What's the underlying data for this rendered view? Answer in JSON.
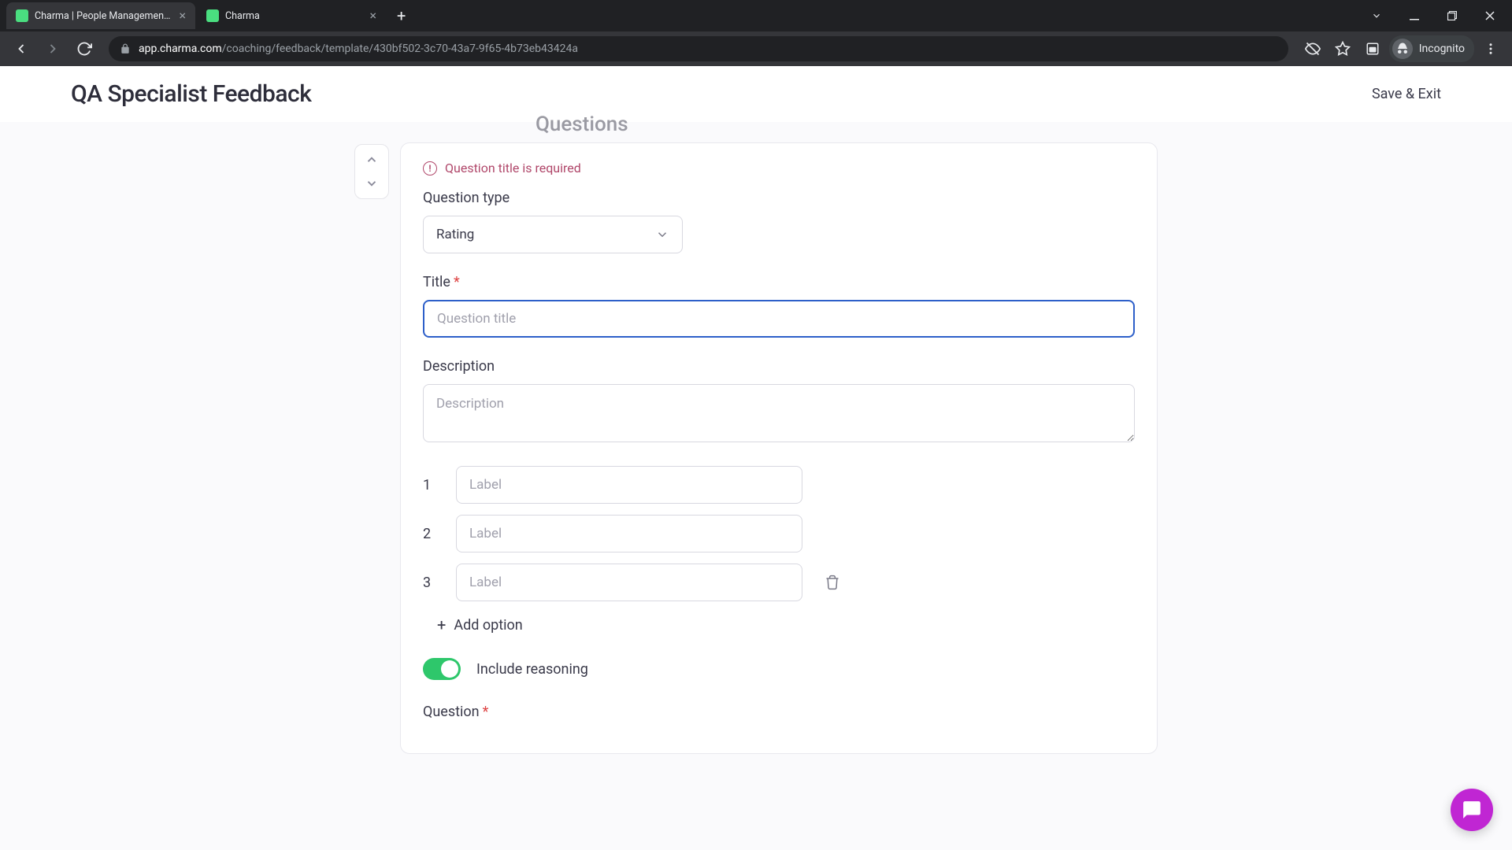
{
  "browser": {
    "tabs": [
      {
        "title": "Charma | People Management S",
        "active": true
      },
      {
        "title": "Charma",
        "active": false
      }
    ],
    "url_host": "app.charma.com",
    "url_path": "/coaching/feedback/template/430bf502-3c70-43a7-9f65-4b73eb43424a",
    "incognito_label": "Incognito"
  },
  "header": {
    "title": "QA Specialist Feedback",
    "save_exit": "Save & Exit"
  },
  "section": {
    "heading": "Questions"
  },
  "question": {
    "error_text": "Question title is required",
    "type_label": "Question type",
    "type_value": "Rating",
    "title_label": "Title",
    "title_placeholder": "Question title",
    "title_value": "",
    "description_label": "Description",
    "description_placeholder": "Description",
    "description_value": "",
    "options": [
      {
        "num": "1",
        "placeholder": "Label",
        "value": ""
      },
      {
        "num": "2",
        "placeholder": "Label",
        "value": ""
      },
      {
        "num": "3",
        "placeholder": "Label",
        "value": ""
      }
    ],
    "add_option_label": "Add option",
    "reasoning_label": "Include reasoning",
    "next_label": "Question"
  }
}
